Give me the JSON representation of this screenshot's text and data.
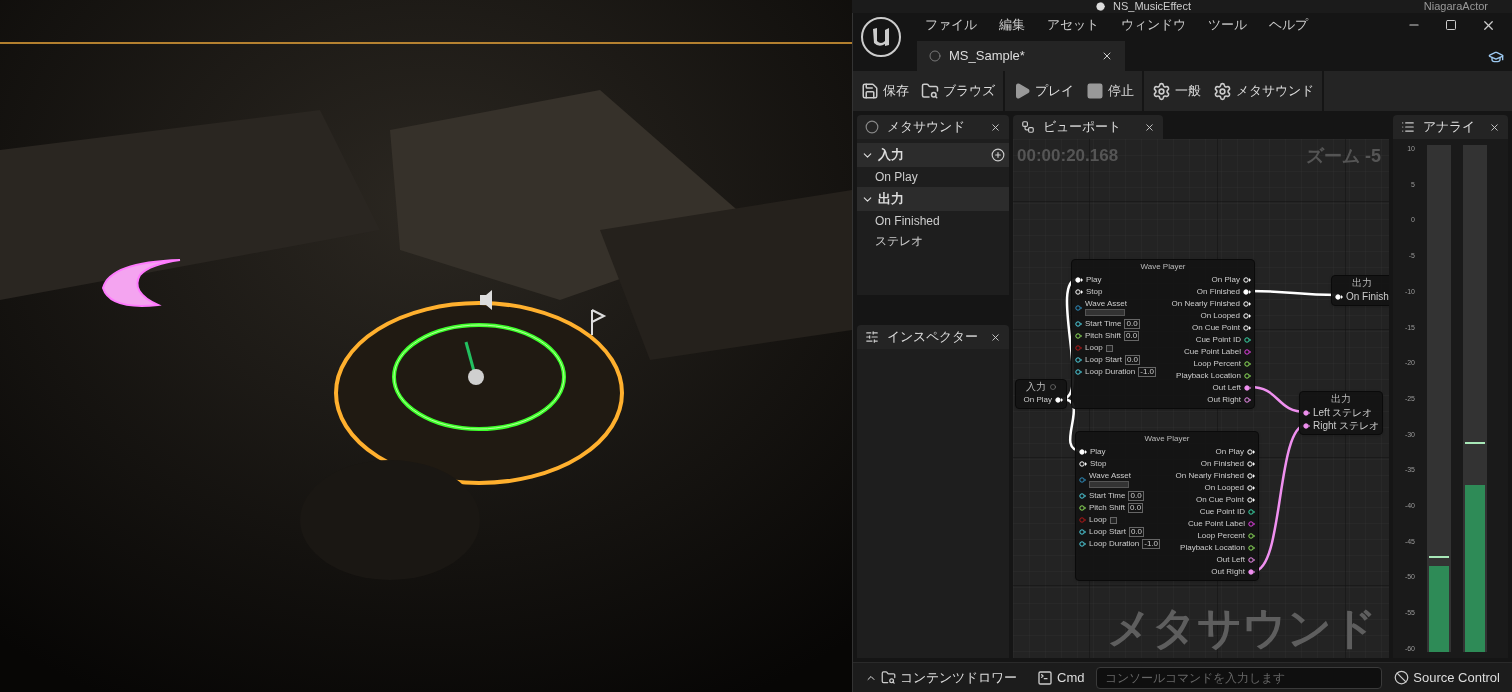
{
  "outliner_row": {
    "name": "NS_MusicEffect",
    "type": "NiagaraActor"
  },
  "menu": [
    "ファイル",
    "編集",
    "アセット",
    "ウィンドウ",
    "ツール",
    "ヘルプ"
  ],
  "tabs": [
    {
      "label": "MS_Sample*",
      "selected": true
    }
  ],
  "toolbar": [
    [
      {
        "kind": "save",
        "label": "保存"
      },
      {
        "kind": "browse",
        "label": "ブラウズ"
      }
    ],
    [
      {
        "kind": "play",
        "label": "プレイ"
      },
      {
        "kind": "stop",
        "label": "停止"
      }
    ],
    [
      {
        "kind": "settings",
        "label": "一般"
      },
      {
        "kind": "settings",
        "label": "メタサウンド"
      }
    ]
  ],
  "members_panel": {
    "tab": "メタサウンド",
    "sections": [
      {
        "title": "入力",
        "expanded": true,
        "addable": true,
        "items": [
          "On Play"
        ]
      },
      {
        "title": "出力",
        "expanded": true,
        "addable": false,
        "items": [
          "On Finished",
          "ステレオ"
        ]
      }
    ]
  },
  "inspector_panel": {
    "tab": "インスペクター"
  },
  "viewport_panel": {
    "tab": "ビューポート",
    "time": "00:00:20.168",
    "zoom": "ズーム -5",
    "watermark": "メタサウンド",
    "nodes": [
      {
        "kind": "input",
        "title": "入力",
        "outputs": [
          {
            "label": "On Play",
            "kind": "trigger",
            "connected": true
          }
        ]
      },
      {
        "kind": "wave_player",
        "title": "Wave Player",
        "inputs": [
          {
            "label": "Play",
            "kind": "trigger",
            "connected": true
          },
          {
            "label": "Stop",
            "kind": "trigger",
            "connected": false
          },
          {
            "label": "Wave Asset",
            "kind": "asset",
            "connected": false
          },
          {
            "label": "Start Time",
            "kind": "time",
            "connected": false,
            "value": "0.0"
          },
          {
            "label": "Pitch Shift",
            "kind": "float",
            "connected": false,
            "value": "0.0"
          },
          {
            "label": "Loop",
            "kind": "bool",
            "connected": false,
            "checked": false
          },
          {
            "label": "Loop Start",
            "kind": "time",
            "connected": false,
            "value": "0.0"
          },
          {
            "label": "Loop Duration",
            "kind": "time",
            "connected": false,
            "value": "-1.0"
          }
        ],
        "outputs": [
          {
            "label": "On Play",
            "kind": "trigger",
            "connected": false
          },
          {
            "label": "On Finished",
            "kind": "trigger",
            "connected": true
          },
          {
            "label": "On Nearly Finished",
            "kind": "trigger",
            "connected": false
          },
          {
            "label": "On Looped",
            "kind": "trigger",
            "connected": false
          },
          {
            "label": "On Cue Point",
            "kind": "trigger",
            "connected": false
          },
          {
            "label": "Cue Point ID",
            "kind": "int",
            "connected": false
          },
          {
            "label": "Cue Point Label",
            "kind": "string",
            "connected": false
          },
          {
            "label": "Loop Percent",
            "kind": "float",
            "connected": false
          },
          {
            "label": "Playback Location",
            "kind": "float",
            "connected": false
          },
          {
            "label": "Out Left",
            "kind": "audio",
            "connected": true
          },
          {
            "label": "Out Right",
            "kind": "audio",
            "connected": false
          }
        ]
      },
      {
        "kind": "wave_player",
        "title": "Wave Player",
        "inputs": [
          {
            "label": "Play",
            "kind": "trigger",
            "connected": true
          },
          {
            "label": "Stop",
            "kind": "trigger",
            "connected": false
          },
          {
            "label": "Wave Asset",
            "kind": "asset",
            "connected": false
          },
          {
            "label": "Start Time",
            "kind": "time",
            "connected": false,
            "value": "0.0"
          },
          {
            "label": "Pitch Shift",
            "kind": "float",
            "connected": false,
            "value": "0.0"
          },
          {
            "label": "Loop",
            "kind": "bool",
            "connected": false,
            "checked": false
          },
          {
            "label": "Loop Start",
            "kind": "time",
            "connected": false,
            "value": "0.0"
          },
          {
            "label": "Loop Duration",
            "kind": "time",
            "connected": false,
            "value": "-1.0"
          }
        ],
        "outputs": [
          {
            "label": "On Play",
            "kind": "trigger",
            "connected": false
          },
          {
            "label": "On Finished",
            "kind": "trigger",
            "connected": false
          },
          {
            "label": "On Nearly Finished",
            "kind": "trigger",
            "connected": false
          },
          {
            "label": "On Looped",
            "kind": "trigger",
            "connected": false
          },
          {
            "label": "On Cue Point",
            "kind": "trigger",
            "connected": false
          },
          {
            "label": "Cue Point ID",
            "kind": "int",
            "connected": false
          },
          {
            "label": "Cue Point Label",
            "kind": "string",
            "connected": false
          },
          {
            "label": "Loop Percent",
            "kind": "float",
            "connected": false
          },
          {
            "label": "Playback Location",
            "kind": "float",
            "connected": false
          },
          {
            "label": "Out Left",
            "kind": "audio",
            "connected": false
          },
          {
            "label": "Out Right",
            "kind": "audio",
            "connected": true
          }
        ]
      },
      {
        "kind": "output",
        "title": "出力",
        "inputs": [
          {
            "label": "On Finish",
            "kind": "trigger",
            "connected": true
          }
        ]
      },
      {
        "kind": "output",
        "title": "出力",
        "inputs": [
          {
            "label": "Left ステレオ",
            "kind": "audio",
            "connected": true
          },
          {
            "label": "Right ステレオ",
            "kind": "audio",
            "connected": true
          }
        ]
      }
    ]
  },
  "analyzer_panel": {
    "tab": "アナライ",
    "scale": [
      "10",
      "5",
      "0",
      "-5",
      "-10",
      "-15",
      "-20",
      "-25",
      "-30",
      "-35",
      "-40",
      "-45",
      "-50",
      "-55",
      "-60"
    ],
    "meters": [
      {
        "level": 0.17
      },
      {
        "level": 0.33
      }
    ],
    "peaks": [
      {
        "level": 0.186
      },
      {
        "level": 0.41
      }
    ]
  },
  "bottom_bar": {
    "drawer": "コンテンツドロワー",
    "cmd": "Cmd",
    "console_placeholder": "コンソールコマンドを入力します",
    "source_control": "Source Control"
  }
}
